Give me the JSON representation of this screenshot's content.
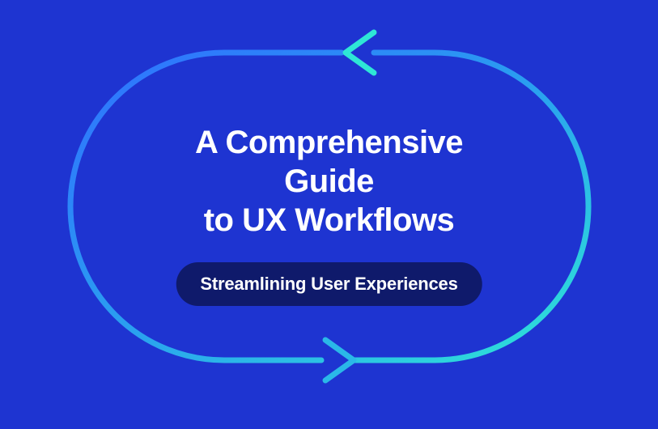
{
  "title_line1": "A Comprehensive Guide",
  "title_line2": "to UX Workflows",
  "subtitle": "Streamlining User Experiences",
  "colors": {
    "background": "#1E34D1",
    "pill": "#0F1A6B",
    "text": "#ffffff",
    "loop_start": "#2F6FFF",
    "loop_end": "#2EE6D6"
  }
}
